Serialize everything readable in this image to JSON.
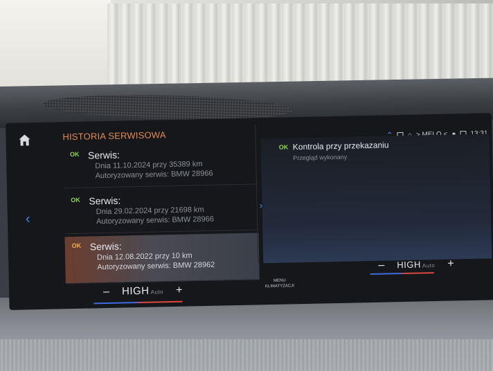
{
  "header": {
    "title": "HISTORIA SERWISOWA"
  },
  "status_bar": {
    "location": "> MELO <",
    "time": "13:31"
  },
  "service_entries": [
    {
      "status": "OK",
      "title": "Serwis:",
      "date_line": "Dnia 11.10.2024 przy 35389 km",
      "workshop_line": "Autoryzowany serwis: BMW 28966"
    },
    {
      "status": "OK",
      "title": "Serwis:",
      "date_line": "Dnia 29.02.2024 przy 21698 km",
      "workshop_line": "Autoryzowany serwis: BMW 28966"
    },
    {
      "status": "OK",
      "title": "Serwis:",
      "date_line": "Dnia 12.08.2022 przy 10 km",
      "workshop_line": "Autoryzowany serwis: BMW 28962"
    }
  ],
  "detail": {
    "status": "OK",
    "title": "Kontrola przy przekazaniu",
    "subtitle": "Przegląd wykonany"
  },
  "climate_left": {
    "minus": "–",
    "temp": "HIGH",
    "auto": "Auto",
    "plus": "+"
  },
  "climate_right": {
    "minus": "–",
    "temp": "HIGH",
    "auto": "Auto",
    "plus": "+"
  },
  "menu_button": {
    "line1": "MENU",
    "line2": "KLIMATYZACJI"
  },
  "colors": {
    "accent_orange": "#e68a52",
    "ok_green": "#8fd64f",
    "nav_blue": "#3d8bf0"
  }
}
